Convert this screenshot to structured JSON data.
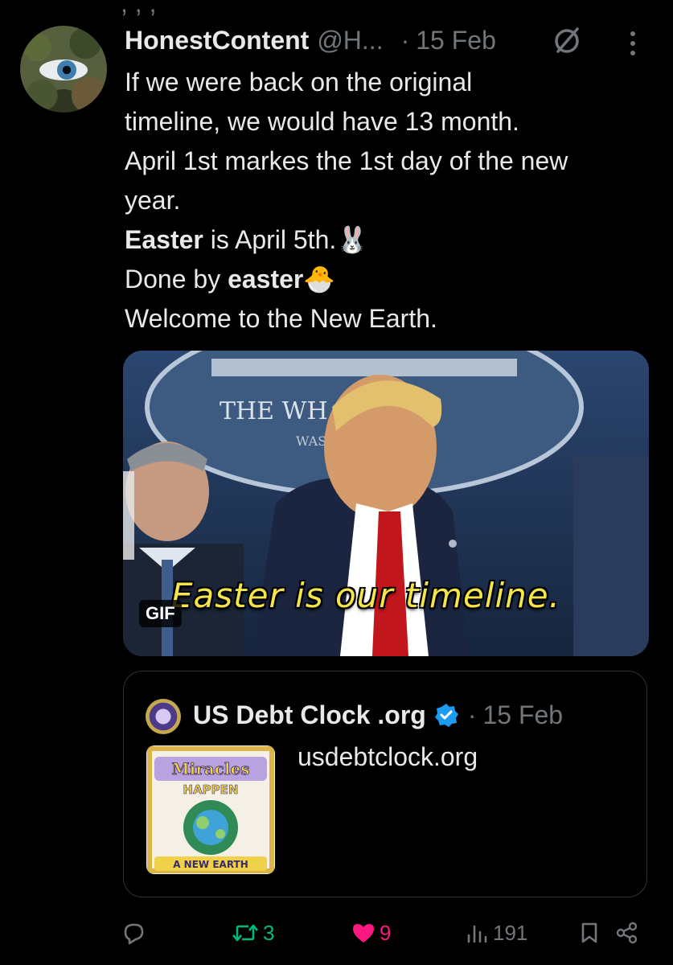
{
  "post": {
    "author_name": "HonestContent",
    "author_handle": "@H...",
    "separator": "·",
    "date": "15 Feb",
    "body": {
      "line1": "If we were back on the original",
      "line2": "timeline, we would have 13 month.",
      "line3": "April 1st markes the 1st day of the new",
      "line4": "year.",
      "line5_bold": "Easter",
      "line5_rest": " is April 5th.",
      "line5_emoji": "🐰",
      "line6_pre": "Done by ",
      "line6_bold": "easter",
      "line6_emoji": "🐣",
      "line7": "Welcome to the New Earth."
    }
  },
  "media": {
    "caption": "Easter is our timeline.",
    "badge": "GIF",
    "backdrop_text": "THE WHITE HOUSE",
    "backdrop_subtext": "WAS"
  },
  "quote": {
    "name": "US Debt Clock .org",
    "separator": "·",
    "date": "15 Feb",
    "text": "usdebtclock.org",
    "thumb_line1": "Miracles",
    "thumb_line2": "HAPPEN",
    "thumb_line3": "A NEW EARTH"
  },
  "actions": {
    "reposts": "3",
    "likes": "9",
    "views": "191"
  },
  "colors": {
    "background": "#000000",
    "text": "#e7e9ea",
    "muted": "#71767b",
    "repost": "#00ba7c",
    "like": "#f91880",
    "verified": "#1d9bf0",
    "caption": "#f4e64a"
  },
  "icons": {
    "grok": "grok-icon",
    "more": "more-icon",
    "reply": "reply-icon",
    "repost": "repost-icon",
    "like": "heart-icon",
    "views": "views-icon",
    "bookmark": "bookmark-icon",
    "share": "share-icon",
    "verified": "verified-icon"
  }
}
